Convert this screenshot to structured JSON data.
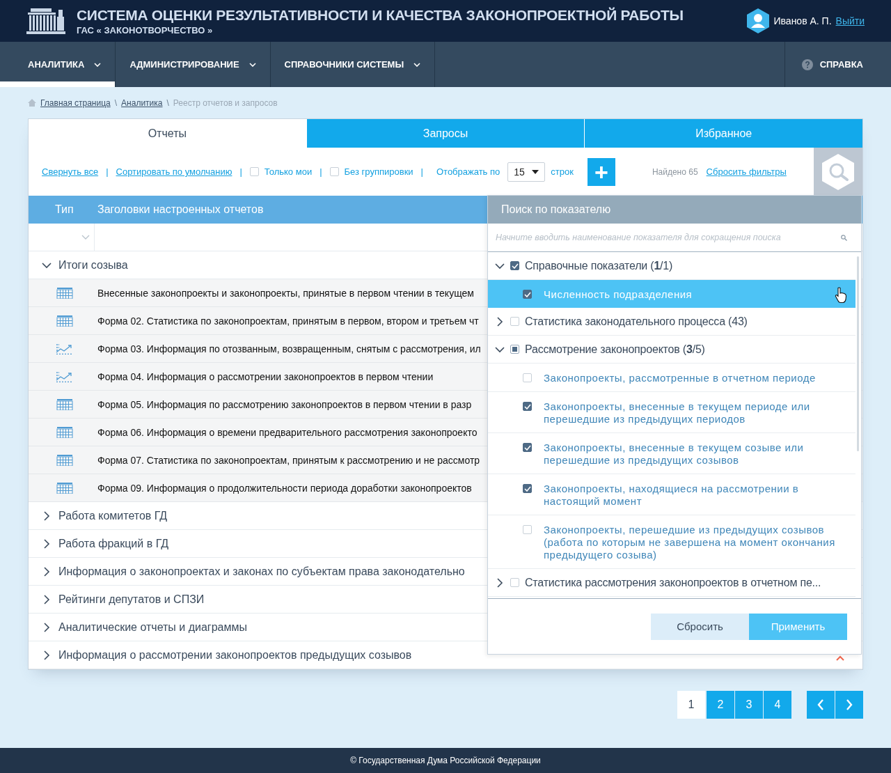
{
  "header": {
    "title": "СИСТЕМА ОЦЕНКИ РЕЗУЛЬТАТИВНОСТИ И КАЧЕСТВА ЗАКОНОПРОЕКТНОЙ РАБОТЫ",
    "subtitle": "ГАС « ЗАКОНОТВОРЧЕСТВО »",
    "user": "Иванов А. П.",
    "logout": "Выйти"
  },
  "nav": {
    "items": [
      {
        "label": "АНАЛИТИКА",
        "selected": true
      },
      {
        "label": "АДМИНИСТРИРОВАНИЕ",
        "selected": false
      },
      {
        "label": "СПРАВОЧНИКИ СИСТЕМЫ",
        "selected": false
      }
    ],
    "help": "СПРАВКА"
  },
  "breadcrumb": {
    "links": [
      "Главная страница",
      "Аналитика"
    ],
    "separator": "\\",
    "current": "Реестр отчетов и запросов"
  },
  "tabs": [
    {
      "label": "Отчеты",
      "selected": true
    },
    {
      "label": "Запросы",
      "selected": false
    },
    {
      "label": "Избранное",
      "selected": false
    }
  ],
  "toolbar": {
    "separator": "|",
    "collapse": "Свернуть все",
    "sort": "Сортировать по умолчанию",
    "only_mine": {
      "label": "Только мои",
      "checked": false
    },
    "no_grouping": {
      "label": "Без группировки",
      "checked": false
    },
    "show_by": "Отображать по",
    "rows_value": "15",
    "rows_suffix": "строк",
    "add": "+",
    "found": "Найдено 65",
    "reset_filters": "Сбросить фильтры"
  },
  "table": {
    "columns": [
      "Тип",
      "Заголовки настроенных отчетов"
    ],
    "groups": [
      {
        "label": "Итоги созыва",
        "expanded": true,
        "reports": [
          {
            "kind": "table",
            "title": "Внесенные законопроекты и законопроекты, принятые в первом чтении в текущем"
          },
          {
            "kind": "table",
            "title": "Форма 02. Статистика по законопроектам, принятым в первом, втором и третьем чт"
          },
          {
            "kind": "chart",
            "title": "Форма 03. Информация по отозванным, возвращенным, снятым с рассмотрения, ил"
          },
          {
            "kind": "chart",
            "title": "Форма 04. Информация о рассмотрении законопроектов в первом чтении"
          },
          {
            "kind": "table",
            "title": "Форма 05. Информация по рассмотрению законопроектов в первом чтении в разр"
          },
          {
            "kind": "table",
            "title": "Форма 06. Информация о времени предварительного рассмотрения законопроекто"
          },
          {
            "kind": "table",
            "title": "Форма 07. Статистика по законопроектам, принятым к рассмотрению и не рассмотр"
          },
          {
            "kind": "table",
            "title": "Форма 09. Информация о продолжительности периода доработки законопроектов"
          }
        ]
      },
      {
        "label": "Работа комитетов ГД",
        "expanded": false
      },
      {
        "label": "Работа фракций в ГД",
        "expanded": false
      },
      {
        "label": "Информация о законопроектах и законах по субъектам права законодательно",
        "expanded": false
      },
      {
        "label": "Рейтинги депутатов и СПЗИ",
        "expanded": false
      },
      {
        "label": "Аналитические отчеты и диаграммы",
        "expanded": false
      },
      {
        "label": "Информация о рассмотрении законопроектов предыдущих созывов",
        "expanded": false
      }
    ]
  },
  "filter_panel": {
    "title": "Поиск по показателю",
    "placeholder": "Начните вводить наименование показателя для сокращения поиска",
    "groups": [
      {
        "label": "Справочные показатели (**1**/1)",
        "expanded": true,
        "checked": true,
        "indeterminate": false,
        "children": [
          {
            "label": "Численность подразделения",
            "checked": true,
            "selected": true
          }
        ]
      },
      {
        "label": "Статистика законодательного процесса (43)",
        "expanded": false,
        "checked": false,
        "indeterminate": false
      },
      {
        "label": "Рассмотрение законопроектов (**3**/5)",
        "expanded": true,
        "checked": false,
        "indeterminate": true,
        "children": [
          {
            "label": "Законопроекты, рассмотренные в отчетном периоде",
            "checked": false,
            "selected": false
          },
          {
            "label": "Законопроекты, внесенные в текущем периоде или перешедшие из предыдущих периодов",
            "checked": true,
            "selected": false
          },
          {
            "label": "Законопроекты, внесенные в текущем созыве или перешедшие из предыдущих созывов",
            "checked": true,
            "selected": false
          },
          {
            "label": "Законопроекты, находящиеся на рассмотрении в настоящий момент",
            "checked": true,
            "selected": false
          },
          {
            "label": "Законопроекты, перешедшие из предыдущих созывов (работа по которым не завершена на момент окончания предыдущего созыва)",
            "checked": false,
            "selected": false
          }
        ]
      },
      {
        "label": "Статистика рассмотрения законопроектов в отчетном пе...",
        "expanded": false,
        "checked": false,
        "indeterminate": false
      }
    ],
    "reset": "Сбросить",
    "apply": "Применить"
  },
  "pagination": {
    "pages": [
      {
        "label": "1",
        "selected": true
      },
      {
        "label": "2",
        "selected": false
      },
      {
        "label": "3",
        "selected": false
      },
      {
        "label": "4",
        "selected": false
      }
    ]
  },
  "footer": "© Государственная Дума Российской Федерации"
}
